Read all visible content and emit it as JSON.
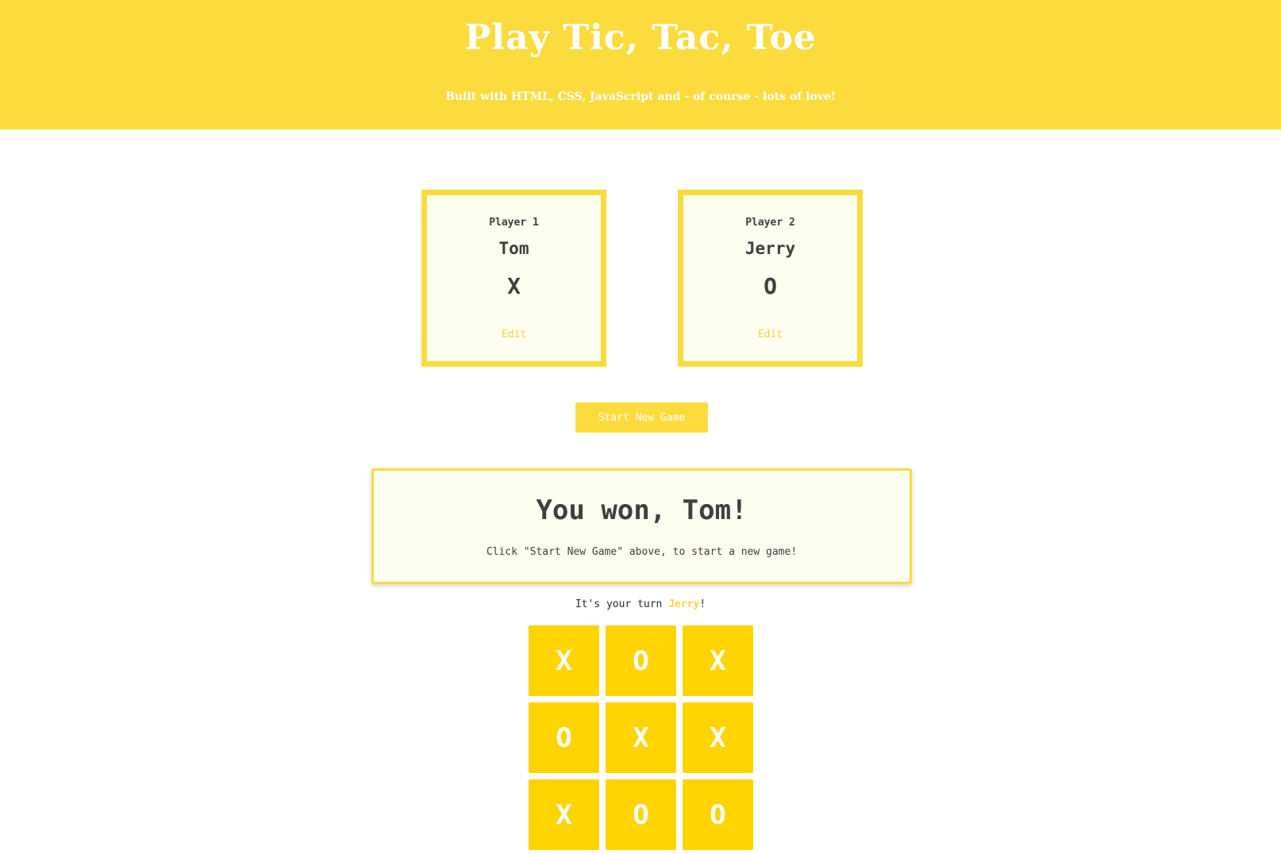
{
  "header": {
    "title": "Play Tic, Tac, Toe",
    "subtitle": "Built with HTML, CSS, JavaScript and - of course - lots of love!"
  },
  "players": [
    {
      "label": "Player 1",
      "name": "Tom",
      "symbol": "X",
      "edit_label": "Edit"
    },
    {
      "label": "Player 2",
      "name": "Jerry",
      "symbol": "O",
      "edit_label": "Edit"
    }
  ],
  "start_button_label": "Start New Game",
  "game_over": {
    "message": "You won, Tom!",
    "hint": "Click \"Start New Game\" above, to start a new game!"
  },
  "turn": {
    "prefix": "It's your turn ",
    "player": "Jerry",
    "suffix": "!"
  },
  "board": [
    [
      "X",
      "O",
      "X"
    ],
    [
      "O",
      "X",
      "X"
    ],
    [
      "X",
      "O",
      "O"
    ]
  ],
  "colors": {
    "accent": "#fcdb3d",
    "cell": "#ffd400",
    "card_bg": "#fdfdf0",
    "text": "#3f3f3f"
  }
}
